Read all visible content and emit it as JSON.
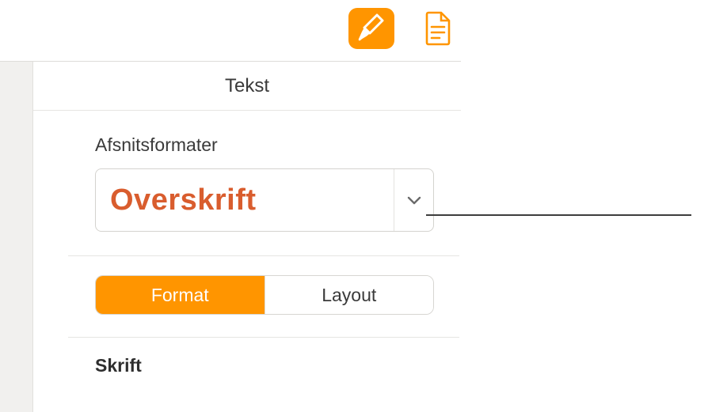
{
  "toolbar": {
    "format_icon_name": "paintbrush-icon",
    "document_icon_name": "document-icon"
  },
  "panel": {
    "tab_label": "Tekst",
    "paragraph_styles_label": "Afsnitsformater",
    "selected_style": "Overskrift",
    "segments": {
      "format": "Format",
      "layout": "Layout"
    },
    "font_section_label": "Skrift"
  },
  "colors": {
    "accent": "#ff9500",
    "heading_text": "#d95d2e"
  }
}
